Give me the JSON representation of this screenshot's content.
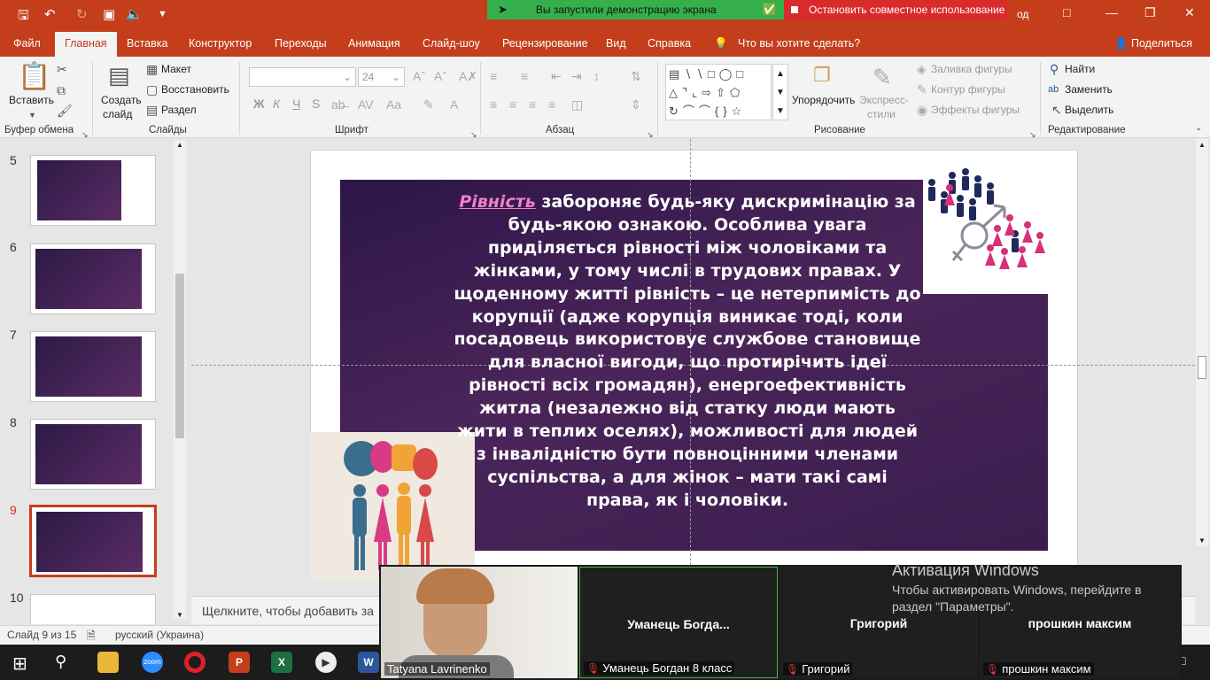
{
  "titlebar": {
    "share_banner": "Вы запустили демонстрацию экрана",
    "stop_banner": "Остановить совместное использование",
    "account_partial": "од"
  },
  "menu": {
    "tabs": [
      "Файл",
      "Главная",
      "Вставка",
      "Конструктор",
      "Переходы",
      "Анимация",
      "Слайд-шоу",
      "Рецензирование",
      "Вид",
      "Справка"
    ],
    "tell_me": "Что вы хотите сделать?",
    "share": "Поделиться"
  },
  "ribbon": {
    "clipboard": {
      "paste": "Вставить",
      "label": "Буфер обмена"
    },
    "slides": {
      "new_slide_1": "Создать",
      "new_slide_2": "слайд",
      "layout": "Макет",
      "reset": "Восстановить",
      "section": "Раздел",
      "label": "Слайды"
    },
    "font": {
      "size": "24",
      "bold": "Ж",
      "italic": "К",
      "underline": "Ч",
      "strike": "S",
      "label": "Шрифт"
    },
    "paragraph": {
      "label": "Абзац"
    },
    "drawing": {
      "arrange": "Упорядочить",
      "styles_1": "Экспресс-",
      "styles_2": "стили",
      "fill": "Заливка фигуры",
      "outline": "Контур фигуры",
      "effects": "Эффекты фигуры",
      "label": "Рисование"
    },
    "editing": {
      "find": "Найти",
      "replace": "Заменить",
      "select": "Выделить",
      "label": "Редактирование"
    }
  },
  "thumbnails": {
    "numbers": [
      "5",
      "6",
      "7",
      "8",
      "9",
      "10"
    ],
    "selected": "9"
  },
  "slide": {
    "highlight_word": "Рівність",
    "body": " забороняє будь-яку дискримінацію за будь-якою ознакою. Особлива увага приділяється рівності між чоловіками та жінками, у тому числі в трудових правах. У щоденному житті рівність – це нетерпимість до корупції (адже корупція виникає тоді, коли посадовець використовує службове становище для власної вигоди, що протирічить ідеї рівності всіх громадян), енергоефективність житла (незалежно від статку люди мають жити в теплих оселях), можливості для людей з інвалідністю бути повноцінними членами суспільства, а для жінок – мати такі самі права, як і чоловіки."
  },
  "notes_placeholder": "Щелкните, чтобы добавить за",
  "status": {
    "slide_counter": "Слайд 9 из 15",
    "language": "русский (Украина)"
  },
  "zoom": {
    "participants": [
      {
        "tile_name": "",
        "label": "Tatyana Lavrinenko",
        "muted": false
      },
      {
        "tile_name": "Уманець  Богда...",
        "label": "Уманець Богдан 8 класс",
        "muted": true
      },
      {
        "tile_name": "Григорий",
        "label": "Григорий",
        "muted": true
      },
      {
        "tile_name": "прошкин максим",
        "label": "прошкин максим",
        "muted": true
      }
    ]
  },
  "activation": {
    "title": "Активация Windows",
    "text1": "Чтобы активировать Windows, перейдите в",
    "text2": "раздел \"Параметры\"."
  },
  "colors": {
    "accent": "#c43e1c",
    "slide_bg": "#3a1d4e",
    "highlight": "#f27fc7",
    "share_green": "#35b04a",
    "stop_red": "#d92b2b"
  }
}
